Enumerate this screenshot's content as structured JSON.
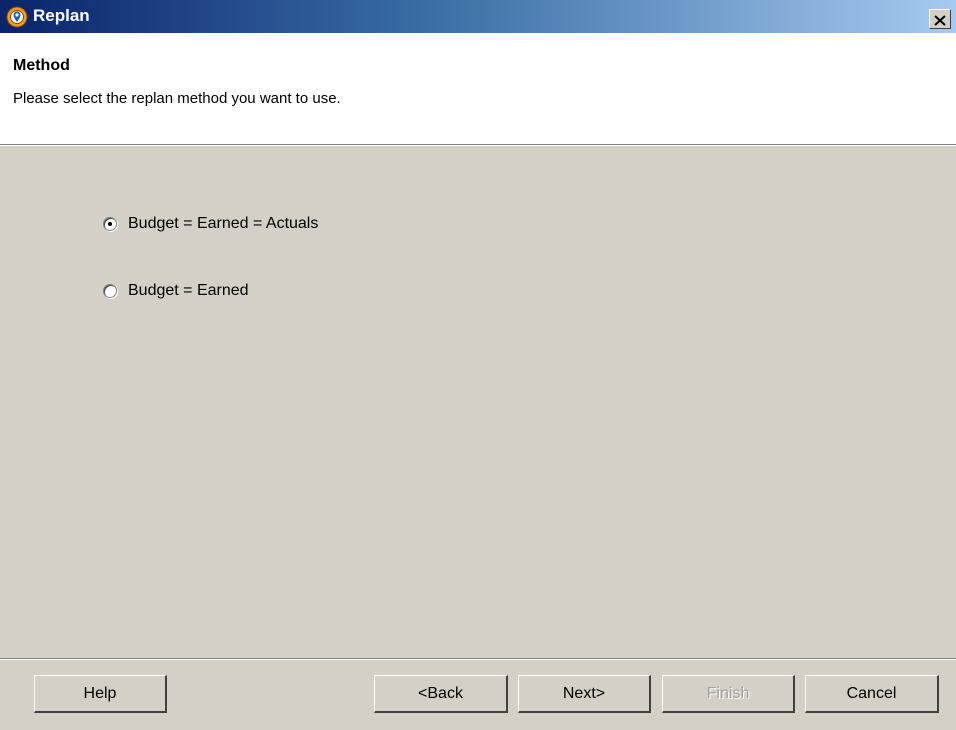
{
  "window": {
    "title": "Replan",
    "icon": "target-location-icon",
    "close_label": "close-icon"
  },
  "header": {
    "title": "Method",
    "subtitle": "Please select the replan method you want to use."
  },
  "options": {
    "items": [
      {
        "label": "Budget = Earned = Actuals",
        "selected": true
      },
      {
        "label": "Budget = Earned",
        "selected": false
      }
    ]
  },
  "buttons": {
    "help": "Help",
    "back": "<Back",
    "next": "Next>",
    "finish": "Finish",
    "cancel": "Cancel"
  },
  "colors": {
    "titlebar_start": "#0a246a",
    "titlebar_end": "#a6caf0",
    "dialog_bg": "#d4d0c8",
    "header_bg": "#ffffff",
    "icon_orange": "#f0a020"
  }
}
